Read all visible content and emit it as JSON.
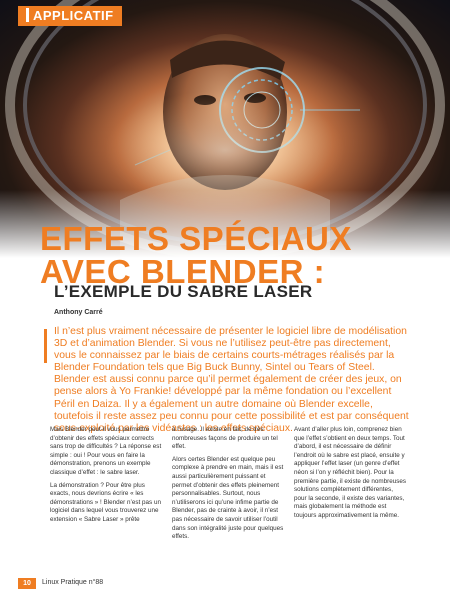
{
  "section": "APPLICATIF",
  "title_line1": "EFFETS SPÉCIAUX",
  "title_line2": "AVEC BLENDER :",
  "subtitle": "L’EXEMPLE DU SABRE LASER",
  "author": "Anthony Carré",
  "chapo": "Il n’est plus vraiment nécessaire de présenter le logiciel libre de modélisation 3D et d’animation Blender. Si vous ne l’utilisez peut-être pas directement, vous le connaissez par le biais de certains courts-métrages réalisés par la Blender Foundation tels que Big Buck Bunny, Sintel ou Tears of Steel. Blender est aussi connu parce qu’il permet également de créer des jeux, on pense alors à Yo Frankie! développé par la même fondation ou l’excellent Péril en Daiza. Il y a également un autre domaine où Blender excelle, toutefois il reste assez peu connu pour cette possibilité et est par conséquent sous-exploité par les vidéastes : les effets spéciaux.",
  "col1": [
    "Mais Blender peut-il vous permettre d’obtenir des effets spéciaux corrects sans trop de difficultés ? La réponse est simple : oui ! Pour vous en faire la démonstration, prenons un exemple classique d’effet : le sabre laser.",
    "La démonstration ? Pour être plus exacts, nous devrions écrire « les démonstrations » ! Blender n’est pas un logiciel dans lequel vous trouverez une extension « Sabre Laser » prête"
  ],
  "col2": [
    "à l’usage. Il existe en fait, de très nombreuses façons de produire un tel effet.",
    "Alors certes Blender est quelque peu complexe à prendre en main, mais il est aussi particulièrement puissant et permet d’obtenir des effets pleinement personnalisables. Surtout, nous n’utiliserons ici qu’une infime partie de Blender, pas de crainte à avoir, il n’est pas nécessaire de savoir utiliser l’outil dans son intégralité juste pour quelques effets."
  ],
  "col3": [
    "Avant d’aller plus loin, comprenez bien que l’effet s’obtient en deux temps. Tout d’abord, il est nécessaire de définir l’endroit où le sabre est placé, ensuite y appliquer l’effet laser (un genre d’effet néon si l’on y réfléchit bien). Pour la première partie, il existe de nombreuses solutions complètement différentes, pour la seconde, il existe des variantes, mais globalement la méthode est toujours approximativement la même."
  ],
  "page_number": "10",
  "magazine": "Linux Pratique n°88",
  "colors": {
    "accent": "#ef7d22",
    "text": "#333333"
  },
  "hero_image": "astronaut-helmet-hud-illustration"
}
